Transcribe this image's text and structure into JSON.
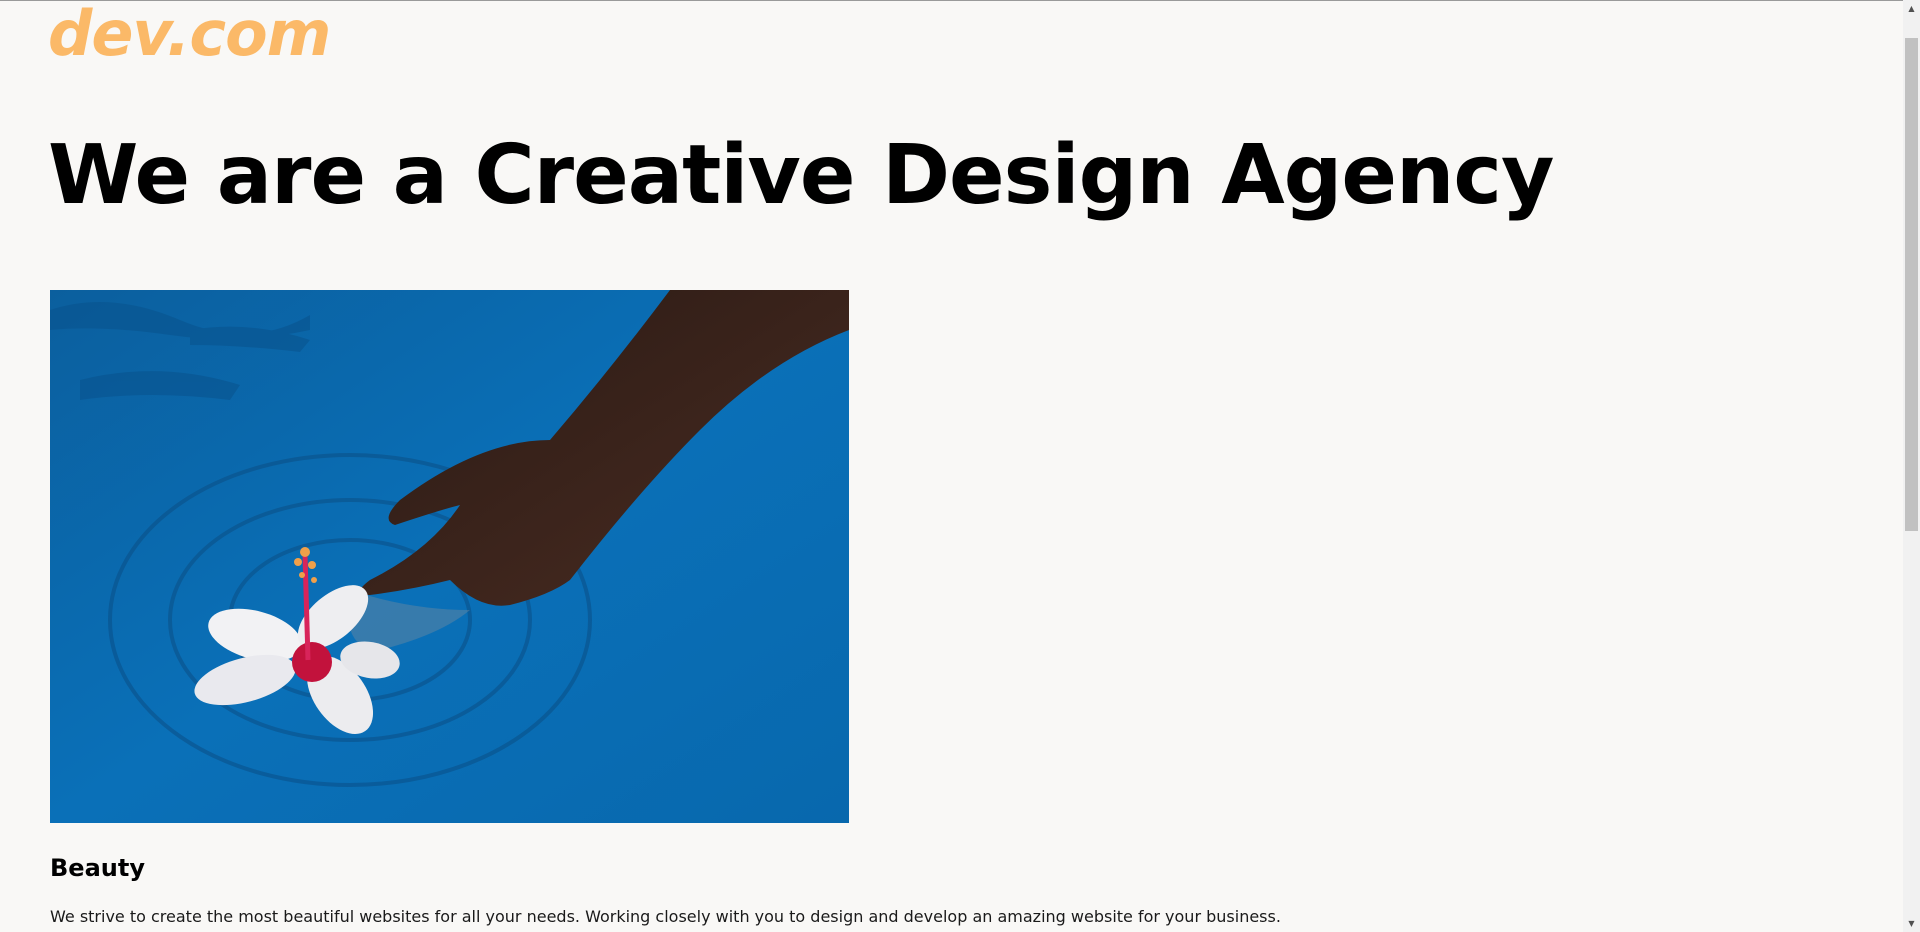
{
  "header": {
    "logo_text": "dev.com",
    "logo_color": "#fbb968"
  },
  "hero": {
    "headline": "We are a Creative Design Agency",
    "image_description_icon": "photo-icon",
    "water_color": "#0a6fb5"
  },
  "feature": {
    "title": "Beauty",
    "text": "We strive to create the most beautiful websites for all your needs. Working closely with you to design and develop an amazing website for your business."
  },
  "scrollbar": {
    "up_icon": "chevron-up-icon",
    "down_icon": "chevron-down-icon"
  }
}
